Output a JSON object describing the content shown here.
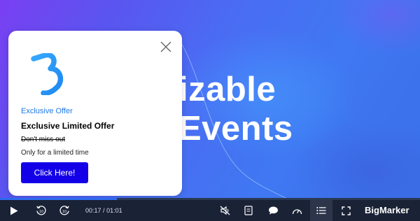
{
  "hero": {
    "line1": "izable",
    "line2": "Events"
  },
  "popup": {
    "tag": "Exclusive Offer",
    "title": "Exclusive Limited Offer",
    "subtitle": "Don't miss out",
    "description": "Only for a limited time",
    "cta_label": "Click Here!",
    "logo_icon": "bigmarker-b-logo-icon",
    "close_icon": "close-icon"
  },
  "player": {
    "current_time": "00:17",
    "separator": "/",
    "duration": "01:01",
    "progress_fraction": 0.279,
    "brand": "BigMarker",
    "icons": [
      "play-icon",
      "rewind-10-icon",
      "forward-10-icon",
      "mute-icon",
      "notes-icon",
      "chat-icon",
      "speed-icon",
      "chapters-list-icon",
      "fullscreen-icon"
    ]
  },
  "colors": {
    "accent": "#1f7ae8",
    "cta": "#1400e8",
    "control_bar": "#1a2236",
    "progress": "#2f6bf0"
  }
}
